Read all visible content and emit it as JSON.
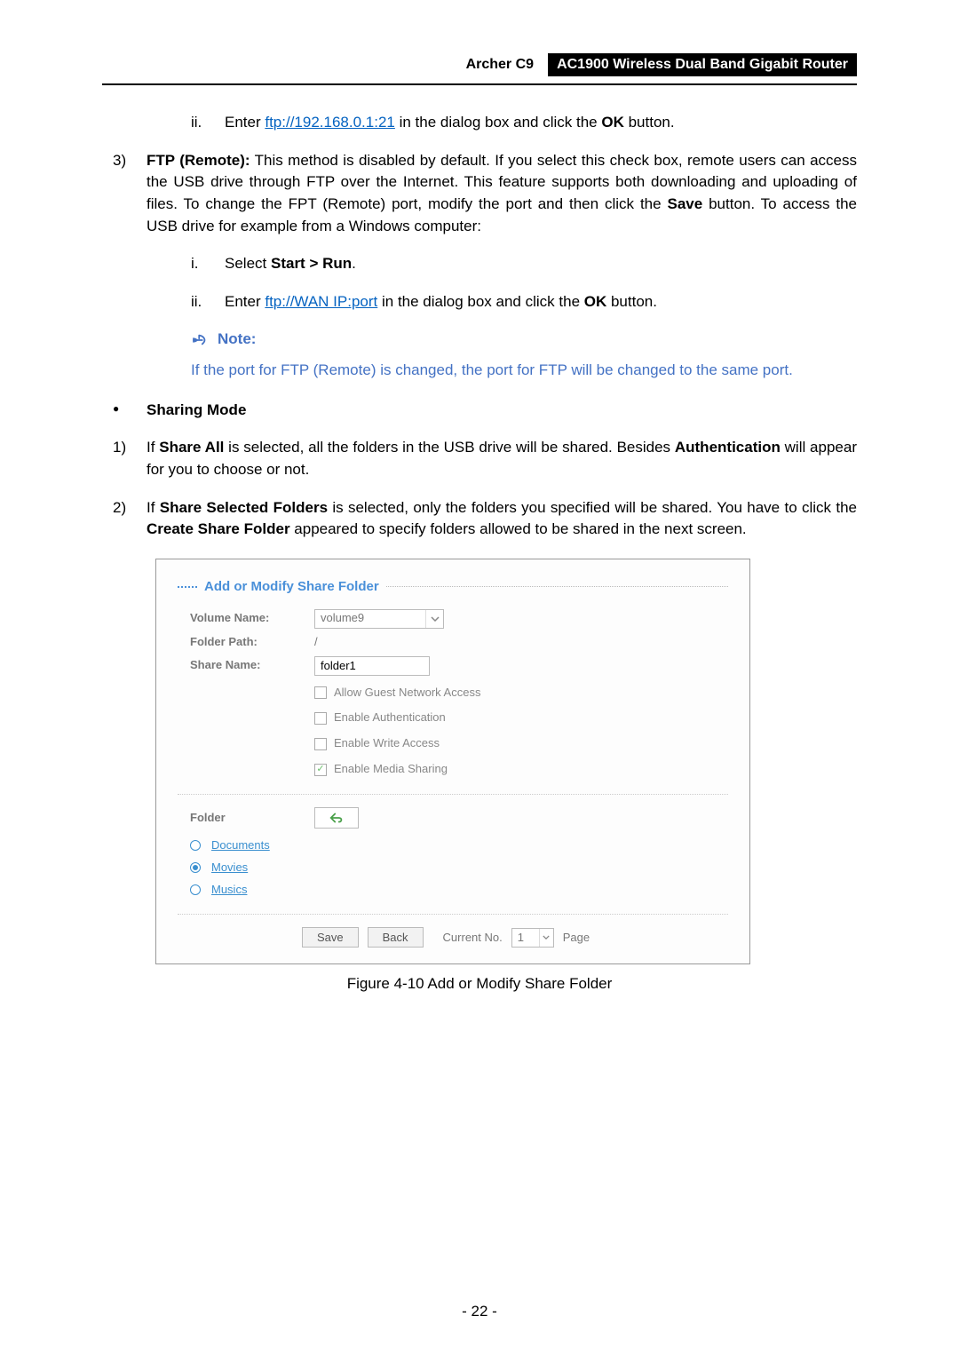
{
  "header": {
    "model": "Archer C9",
    "product": "AC1900 Wireless Dual Band Gigabit Router"
  },
  "text": {
    "ii1_a": "ii.",
    "ii1_b1": "Enter ",
    "ii1_link": "ftp://192.168.0.1:21",
    "ii1_b2": " in the dialog box and click the ",
    "ii1_b3": "OK",
    "ii1_b4": " button.",
    "n3": "3)",
    "p3_b1": "FTP (Remote):",
    "p3_b2": " This method is disabled by default. If you select this check box, remote users can access the USB drive through FTP over the Internet. This feature supports both downloading and uploading of files. To change the FPT (Remote) port, modify the port and then click the ",
    "p3_b3": "Save",
    "p3_b4": " button. To access the USB drive for example from a Windows computer:",
    "i_a": "i.",
    "i_b1": "Select ",
    "i_b2": "Start > Run",
    "i_b3": ".",
    "ii2_a": "ii.",
    "ii2_b1": "Enter ",
    "ii2_link": "ftp://WAN IP:port",
    "ii2_b2": " in the dialog box and click the ",
    "ii2_b3": "OK",
    "ii2_b4": " button.",
    "note_label": "Note:",
    "note_body": "If the port for FTP (Remote) is changed, the port for FTP will be changed to the same port.",
    "bullet_heading": "Sharing Mode",
    "n1": "1)",
    "p1_a": "If ",
    "p1_b": "Share All",
    "p1_c": " is selected, all the folders in the USB drive will be shared. Besides ",
    "p1_d": "Authentication",
    "p1_e": " will appear for you to choose or not.",
    "n2": "2)",
    "p2_a": "If ",
    "p2_b": "Share Selected Folders",
    "p2_c": " is selected, only the folders you specified will be shared. You have to click the ",
    "p2_d": "Create Share Folder",
    "p2_e": " appeared to specify folders allowed to be shared in the next screen."
  },
  "figure": {
    "title": "Add or Modify Share Folder",
    "labels": {
      "volume": "Volume Name:",
      "path": "Folder Path:",
      "share": "Share Name:"
    },
    "values": {
      "volume": "volume9",
      "path": "/",
      "share": "folder1"
    },
    "checks": {
      "guest": "Allow Guest Network Access",
      "auth": "Enable Authentication",
      "write": "Enable Write Access",
      "media": "Enable Media Sharing"
    },
    "folder_label": "Folder",
    "folders": {
      "docs": "Documents",
      "movies": "Movies",
      "musics": "Musics"
    },
    "footer": {
      "save": "Save",
      "back": "Back",
      "current": "Current No.",
      "page_val": "1",
      "page": "Page"
    },
    "caption": "Figure 4-10 Add or Modify Share Folder"
  },
  "page_number": "- 22 -"
}
